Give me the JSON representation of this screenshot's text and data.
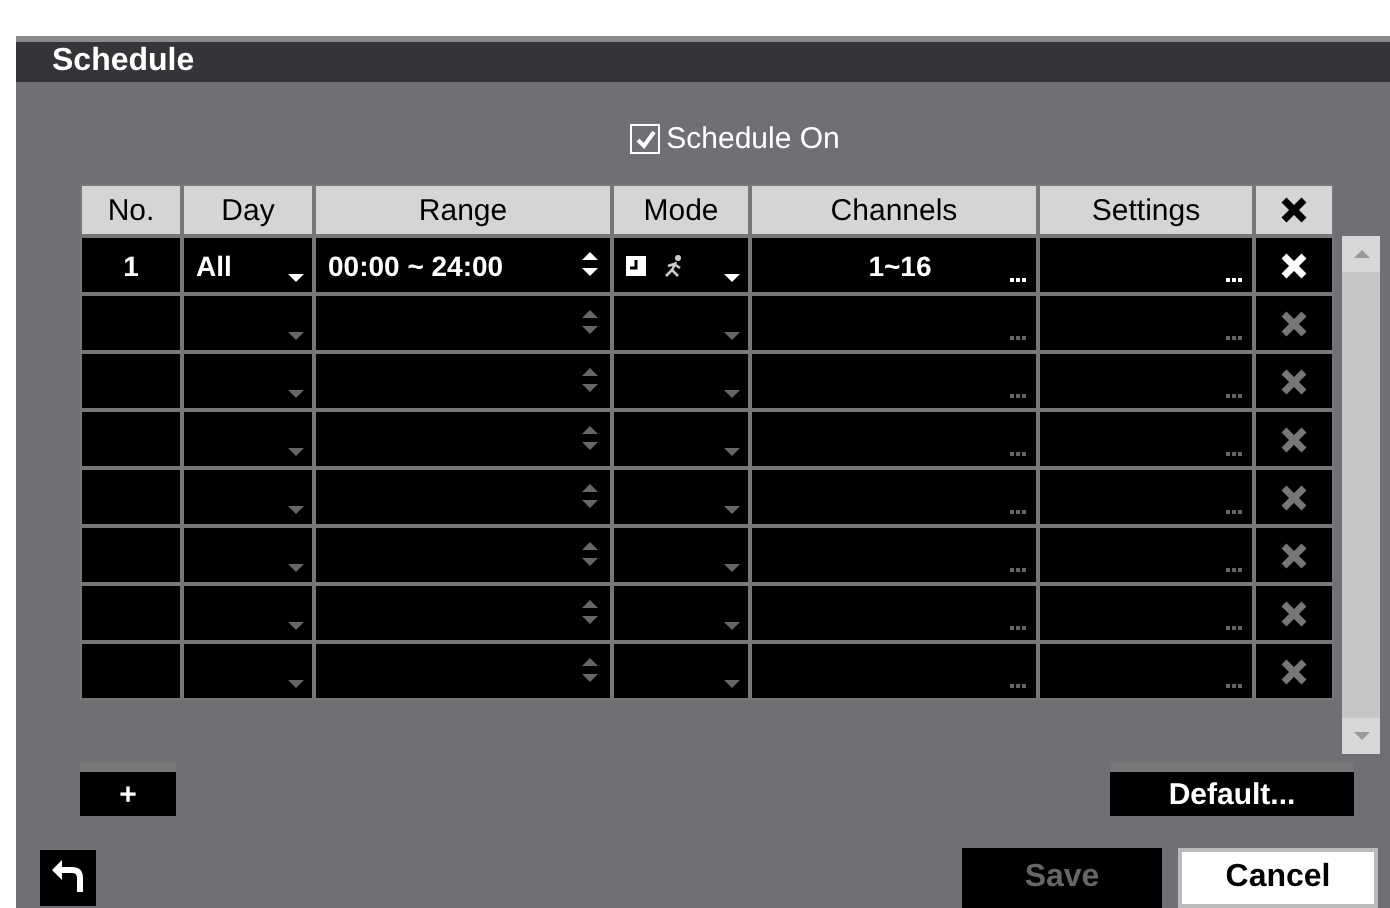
{
  "window": {
    "title": "Schedule"
  },
  "schedule_on": {
    "label": "Schedule On",
    "checked": true
  },
  "table": {
    "columns": [
      "No.",
      "Day",
      "Range",
      "Mode",
      "Channels",
      "Settings"
    ],
    "rows": [
      {
        "no": "1",
        "day": "All",
        "range": "00:00 ~ 24:00",
        "channels": "1~16",
        "active": true
      },
      {
        "active": false
      },
      {
        "active": false
      },
      {
        "active": false
      },
      {
        "active": false
      },
      {
        "active": false
      },
      {
        "active": false
      },
      {
        "active": false
      }
    ]
  },
  "add_button": {
    "label": "+"
  },
  "default_button": {
    "label": "Default..."
  },
  "buttons": [
    {
      "label": "Save",
      "disabled": true,
      "focused": false
    },
    {
      "label": "Cancel",
      "disabled": false,
      "focused": true
    }
  ]
}
